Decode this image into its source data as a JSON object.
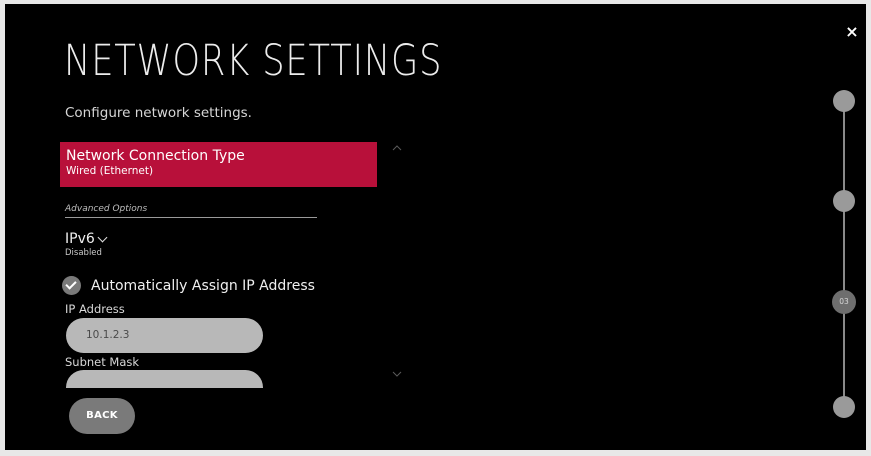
{
  "header": {
    "title": "NETWORK SETTINGS",
    "subtitle": "Configure network settings.",
    "close_label": "×"
  },
  "connection_type": {
    "title": "Network Connection Type",
    "value": "Wired (Ethernet)"
  },
  "advanced": {
    "label": "Advanced Options"
  },
  "ipv6": {
    "title": "IPv6",
    "value": "Disabled"
  },
  "auto_assign": {
    "label": "Automatically Assign IP Address",
    "checked": true
  },
  "ip_address": {
    "label": "IP Address",
    "value": "10.1.2.3"
  },
  "subnet_mask": {
    "label": "Subnet Mask",
    "value": ""
  },
  "footer": {
    "back_label": "BACK"
  },
  "stepper": {
    "current_label": "03"
  },
  "colors": {
    "accent": "#b8103a",
    "background": "#000000",
    "field": "#b8b8b8",
    "button": "#7a7a7a"
  },
  "icons": {
    "close": "close-icon",
    "check": "check-circle-icon",
    "chevron": "chevron-down-icon",
    "scroll_up": "chevron-up-icon",
    "scroll_down": "chevron-down-icon"
  }
}
